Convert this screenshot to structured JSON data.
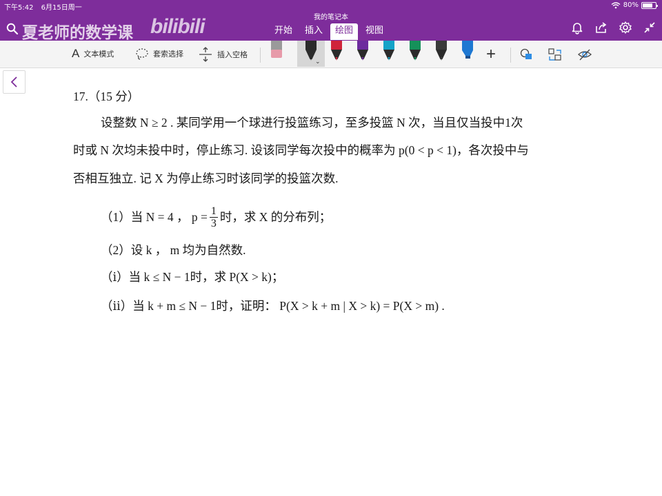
{
  "status_bar": {
    "time": "下午5:42",
    "date": "6月15日周一",
    "battery": "80%",
    "battery_level": 0.8
  },
  "header": {
    "notebook_title": "我的笔记本",
    "watermark": "夏老师的数学课",
    "brand_logo": "bilibili",
    "tabs": [
      {
        "label": "开始",
        "active": false
      },
      {
        "label": "插入",
        "active": false
      },
      {
        "label": "绘图",
        "active": true
      },
      {
        "label": "视图",
        "active": false
      }
    ],
    "accent_color": "#7e2d9b"
  },
  "toolbar": {
    "text_mode": {
      "glyph": "A",
      "label": "文本模式"
    },
    "lasso": {
      "label": "套索选择"
    },
    "insert_space": {
      "label": "插入空格"
    },
    "pens": [
      {
        "name": "eraser",
        "color": "#e79aa9"
      },
      {
        "name": "pen-black",
        "color": "#2a2a2a",
        "selected": true
      },
      {
        "name": "pen-red",
        "color": "#d0243a"
      },
      {
        "name": "pen-purple",
        "color": "#6d2b9e"
      },
      {
        "name": "pen-cyan",
        "color": "#14a3c8"
      },
      {
        "name": "pen-green",
        "color": "#15915a"
      },
      {
        "name": "pen-gray",
        "color": "#3a3a3a"
      },
      {
        "name": "highlighter-blue",
        "color": "#1e78d2"
      }
    ],
    "add_glyph": "+"
  },
  "page": {
    "problem_header": "17.（15 分）",
    "para_line1": "设整数 N ≥ 2 . 某同学用一个球进行投篮练习，至多投篮 N 次，当且仅当投中1次",
    "para_line2": "时或 N 次均未投中时，停止练习. 设该同学每次投中的概率为 p(0 < p < 1)，各次投中与",
    "para_line3": "否相互独立. 记 X 为停止练习时该同学的投篮次数.",
    "q1_prefix": "（1）当 N = 4 ，  p =",
    "q1_frac_num": "1",
    "q1_frac_den": "3",
    "q1_suffix": "时，求 X 的分布列；",
    "q2": "（2）设 k ， m 均为自然数.",
    "q2_i": "（ⅰ）当 k ≤ N − 1时，求 P(X > k)；",
    "q2_ii": "（ⅱ）当 k + m ≤ N − 1时，证明： P(X > k + m | X > k) = P(X > m) ."
  }
}
